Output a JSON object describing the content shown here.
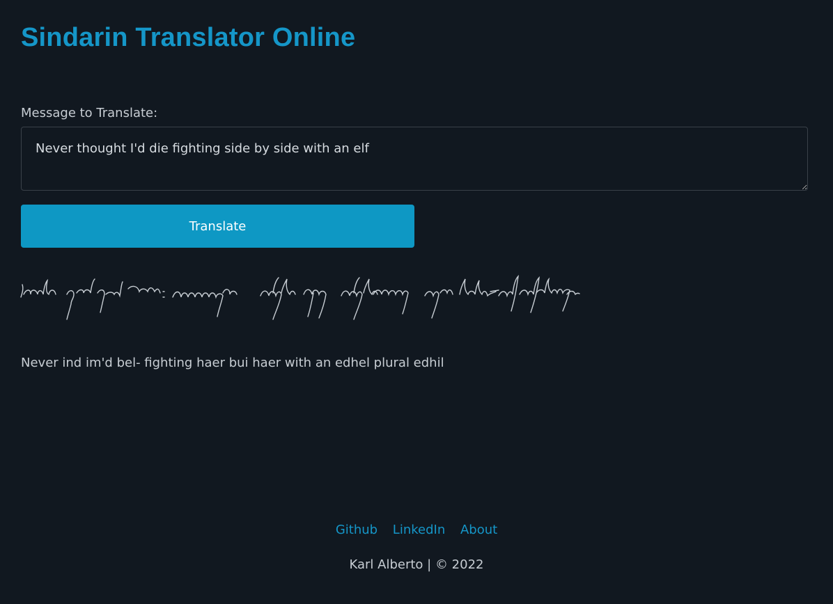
{
  "header": {
    "title": "Sindarin Translator Online"
  },
  "form": {
    "label": "Message to Translate:",
    "message_value": "Never thought I'd die fighting side by side with an elf",
    "translate_label": "Translate"
  },
  "output": {
    "translation_text": "Never ind im'd bel- fighting haer bui haer with an edhel plural edhil"
  },
  "footer": {
    "links": [
      "Github",
      "LinkedIn",
      "About"
    ],
    "copyright": "Karl Alberto | © 2022"
  },
  "colors": {
    "background": "#111820",
    "accent": "#1596c8",
    "button": "#0e98c4",
    "text": "#c7cdd3"
  }
}
